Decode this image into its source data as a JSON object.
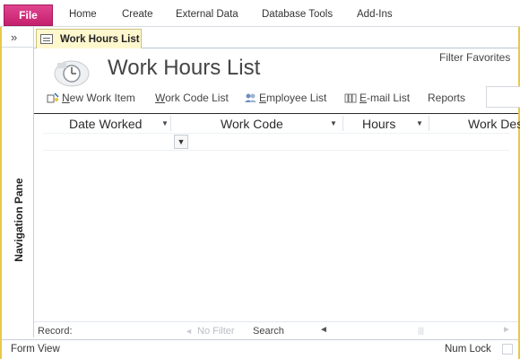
{
  "ribbon": {
    "file_label": "File",
    "tabs": [
      {
        "label": "Home"
      },
      {
        "label": "Create"
      },
      {
        "label": "External Data"
      },
      {
        "label": "Database Tools"
      },
      {
        "label": "Add-Ins"
      }
    ]
  },
  "navigation_pane": {
    "toggle_glyph": "»",
    "label": "Navigation Pane"
  },
  "document_tab": {
    "label": "Work Hours List",
    "icon": "form-icon"
  },
  "form": {
    "title": "Work Hours List",
    "filter_favorites": "Filter Favorites",
    "header_icon": "clock-icon",
    "toolbar": [
      {
        "label": "New Work Item",
        "icon": "new-item-icon"
      },
      {
        "label": "Work Code List",
        "icon": ""
      },
      {
        "label": "Employee List",
        "icon": "employee-icon"
      },
      {
        "label": "E-mail List",
        "icon": "email-icon"
      },
      {
        "label": "Reports",
        "icon": ""
      }
    ]
  },
  "datasheet": {
    "columns": [
      {
        "label": "Date Worked"
      },
      {
        "label": "Work Code"
      },
      {
        "label": "Hours"
      },
      {
        "label": "Work Des"
      }
    ],
    "rows": []
  },
  "record_nav": {
    "record_label": "Record:",
    "filter_label": "No Filter",
    "search_label": "Search"
  },
  "status_bar": {
    "left": "Form View",
    "right": "Num Lock"
  },
  "colors": {
    "file_tab": "#c51f6e",
    "doc_tab_bg": "#fff8cf",
    "window_border": "#e8c84a"
  }
}
